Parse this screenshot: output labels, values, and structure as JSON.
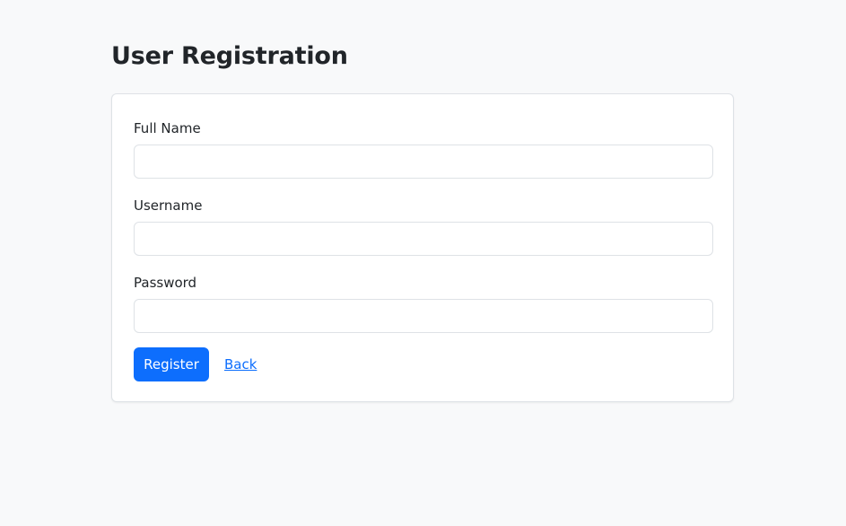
{
  "page": {
    "title": "User Registration"
  },
  "form": {
    "full_name": {
      "label": "Full Name",
      "value": "",
      "placeholder": ""
    },
    "username": {
      "label": "Username",
      "value": "",
      "placeholder": ""
    },
    "password": {
      "label": "Password",
      "value": "",
      "placeholder": ""
    },
    "register_label": "Register",
    "back_label": "Back"
  },
  "colors": {
    "background": "#f8f9fa",
    "card": "#ffffff",
    "primary": "#0d6efd",
    "border": "#dee2e6",
    "text": "#212529"
  }
}
